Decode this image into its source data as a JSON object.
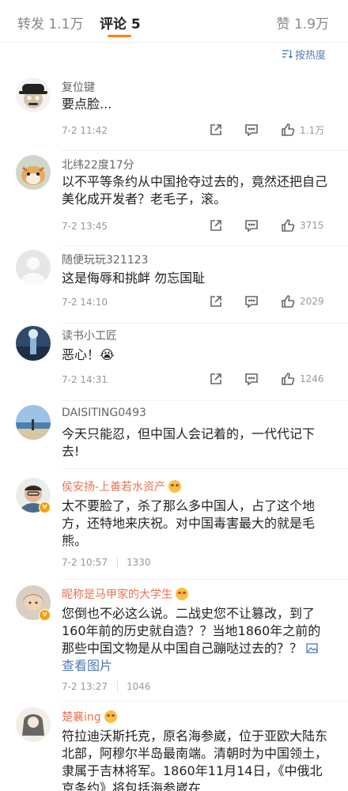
{
  "tabs": {
    "repost": "转发 1.1万",
    "comments": "评论 5",
    "likes": "赞 1.9万"
  },
  "sort_label": "按热度",
  "accent": "#ff8200",
  "comments": [
    {
      "user": "复位键",
      "text": "要点脸...",
      "time": "7-2 11:42",
      "likes": "1.1万"
    },
    {
      "user": "北纬22度17分",
      "text": "以不平等条约从中国抢夺过去的，竟然还把自己美化成开发者？老毛子，滚。",
      "time": "7-2 13:45",
      "likes": "3715"
    },
    {
      "user": "随便玩玩321123",
      "text": "这是侮辱和挑衅 勿忘国耻",
      "time": "7-2 14:10",
      "likes": "2029"
    },
    {
      "user": "读书小工匠",
      "text": "恶心！😭",
      "time": "7-2 14:31",
      "likes": "1246"
    },
    {
      "user": "DAISITING0493",
      "text": "今天只能忍，但中国人会记着的，一代代记下去!"
    },
    {
      "user": "侯安扬-上善若水资产",
      "text": "太不要脸了，杀了那么多中国人，占了这个地方，还特地来庆祝。对中国毒害最大的就是毛熊。",
      "time": "7-2 10:57",
      "likes": "1330"
    },
    {
      "user": "昵称是马甲家的大学生",
      "text": "您倒也不必这么说。二战史您不让篡改，到了160年前的历史就自造？？当地1860年之前的那些中国文物是从中国自己蹦哒过去的？？",
      "link": "查看图片",
      "time": "7-2 13:27",
      "likes": "1046"
    },
    {
      "user": "楚襄ing",
      "text": "符拉迪沃斯托克，原名海参崴，位于亚欧大陆东北部，阿穆尔半岛最南端。清朝时为中国领土，隶属于吉林将军。1860年11月14日，《中俄北京条约》将包括海参崴在"
    }
  ]
}
